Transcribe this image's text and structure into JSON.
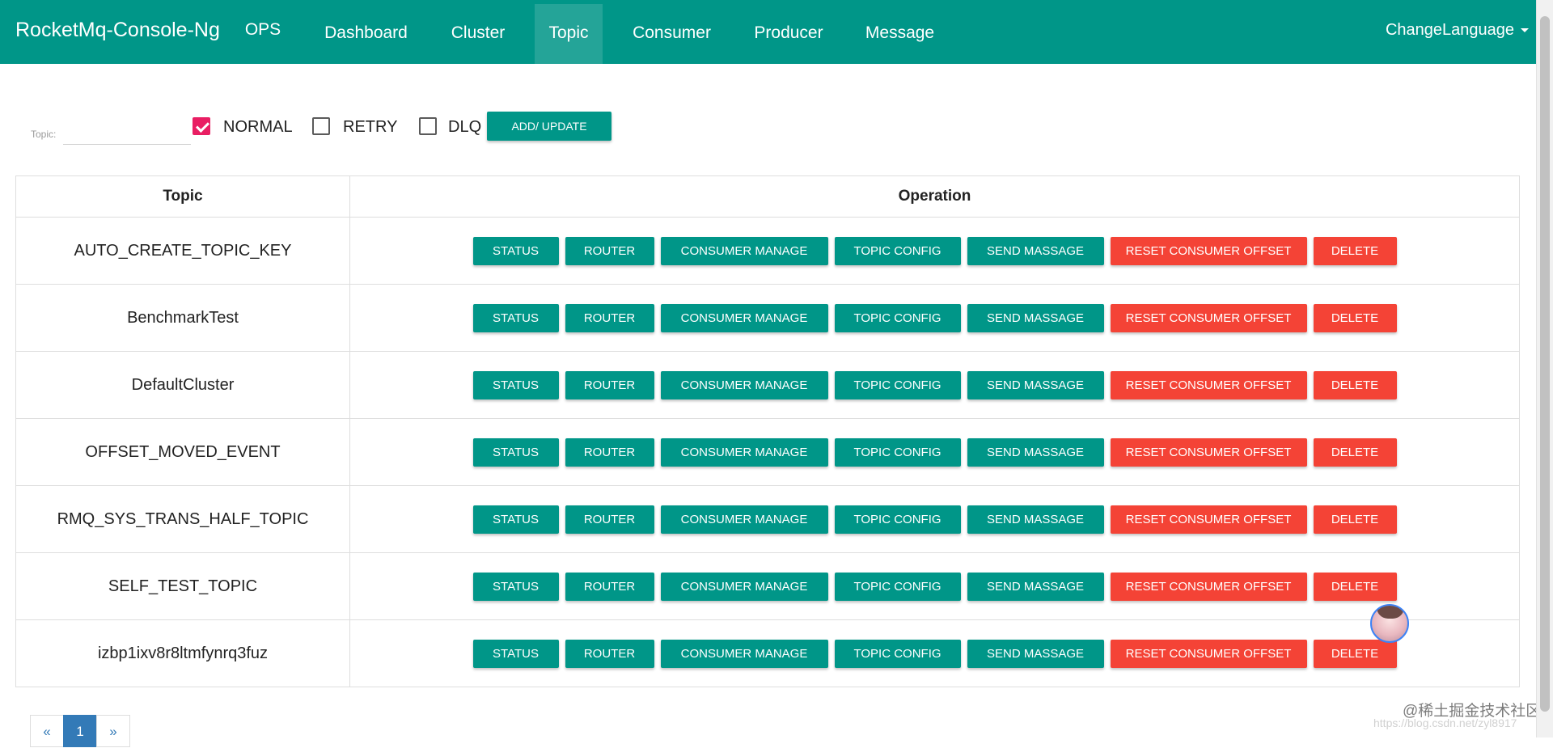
{
  "navbar": {
    "brand": "RocketMq-Console-Ng",
    "items": [
      "OPS",
      "Dashboard",
      "Cluster",
      "Topic",
      "Consumer",
      "Producer",
      "Message"
    ],
    "active": "Topic",
    "change_language": "ChangeLanguage"
  },
  "filter": {
    "topic_label": "Topic:",
    "topic_value": "",
    "checkboxes": [
      {
        "label": "NORMAL",
        "checked": true
      },
      {
        "label": "RETRY",
        "checked": false
      },
      {
        "label": "DLQ",
        "checked": false
      }
    ],
    "add_update_label": "ADD/ UPDATE"
  },
  "table": {
    "headers": [
      "Topic",
      "Operation"
    ],
    "operations": [
      "STATUS",
      "ROUTER",
      "CONSUMER MANAGE",
      "TOPIC CONFIG",
      "SEND MASSAGE",
      "RESET CONSUMER OFFSET",
      "DELETE"
    ],
    "rows": [
      "AUTO_CREATE_TOPIC_KEY",
      "BenchmarkTest",
      "DefaultCluster",
      "OFFSET_MOVED_EVENT",
      "RMQ_SYS_TRANS_HALF_TOPIC",
      "SELF_TEST_TOPIC",
      "izbp1ixv8r8ltmfynrq3fuz"
    ]
  },
  "pagination": {
    "prev": "«",
    "current": "1",
    "next": "»"
  },
  "watermark": {
    "text": "@稀土掘金技术社区",
    "url": "https://blog.csdn.net/zyl8917"
  },
  "colors": {
    "primary": "#009688",
    "danger": "#f44336",
    "checkbox": "#e91e63",
    "page_active": "#337ab7"
  },
  "icons": {
    "avatar": "user-avatar-icon",
    "caret": "caret-down-icon",
    "checkbox": "checkbox-icon"
  }
}
